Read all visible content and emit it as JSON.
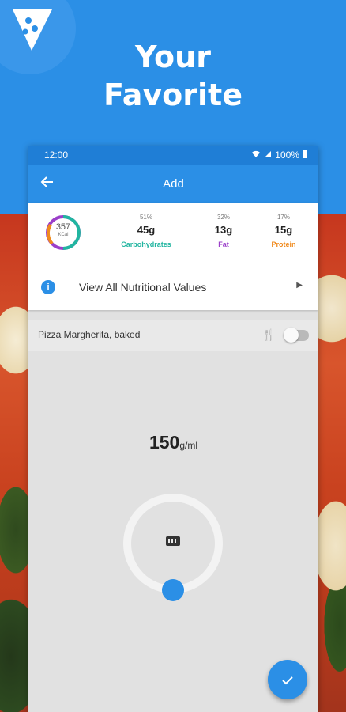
{
  "hero": {
    "title_line1": "Your",
    "title_line2": "Favorite"
  },
  "status_bar": {
    "time": "12:00",
    "battery": "100%"
  },
  "app_bar": {
    "title": "Add"
  },
  "nutrition": {
    "kcal_value": "357",
    "kcal_unit": "KCal",
    "macros": [
      {
        "percent": "51%",
        "grams": "45g",
        "name": "Carbohydrates",
        "color": "#21b5a0"
      },
      {
        "percent": "32%",
        "grams": "13g",
        "name": "Fat",
        "color": "#9b3fc9"
      },
      {
        "percent": "17%",
        "grams": "15g",
        "name": "Protein",
        "color": "#f08a1d"
      }
    ],
    "view_all_label": "View All Nutritional Values"
  },
  "food": {
    "name": "Pizza Margherita, baked"
  },
  "amount": {
    "value": "150",
    "unit": "g/ml"
  },
  "colors": {
    "primary": "#2b8fe6",
    "status": "#1f7ed6"
  }
}
